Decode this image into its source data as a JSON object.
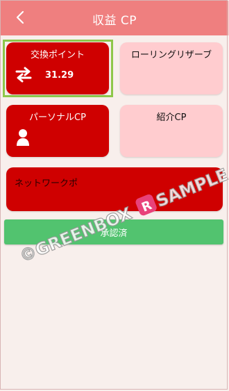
{
  "header": {
    "title": "収益 CP",
    "back_icon": "chevron-left-icon"
  },
  "cards": {
    "exchange_points": {
      "label": "交換ポイント",
      "value": "31.29",
      "icon": "swap-arrows-icon"
    },
    "rolling_reserve": {
      "label": "ローリングリザーブ"
    },
    "personal_cp": {
      "label": "パーソナルCP",
      "icon": "person-icon"
    },
    "referral_cp": {
      "label": "紹介CP"
    },
    "network_cp": {
      "label": "ネットワークポ"
    }
  },
  "approve_button": {
    "label": "承認済"
  },
  "watermark": {
    "text": "©GREENBOX",
    "text2": "SAMPLE"
  },
  "colors": {
    "header": "#ef7f7f",
    "card_red": "#cf0000",
    "card_pink": "#ffcccf",
    "approve": "#52c36f",
    "highlight": "#8dc74a"
  }
}
